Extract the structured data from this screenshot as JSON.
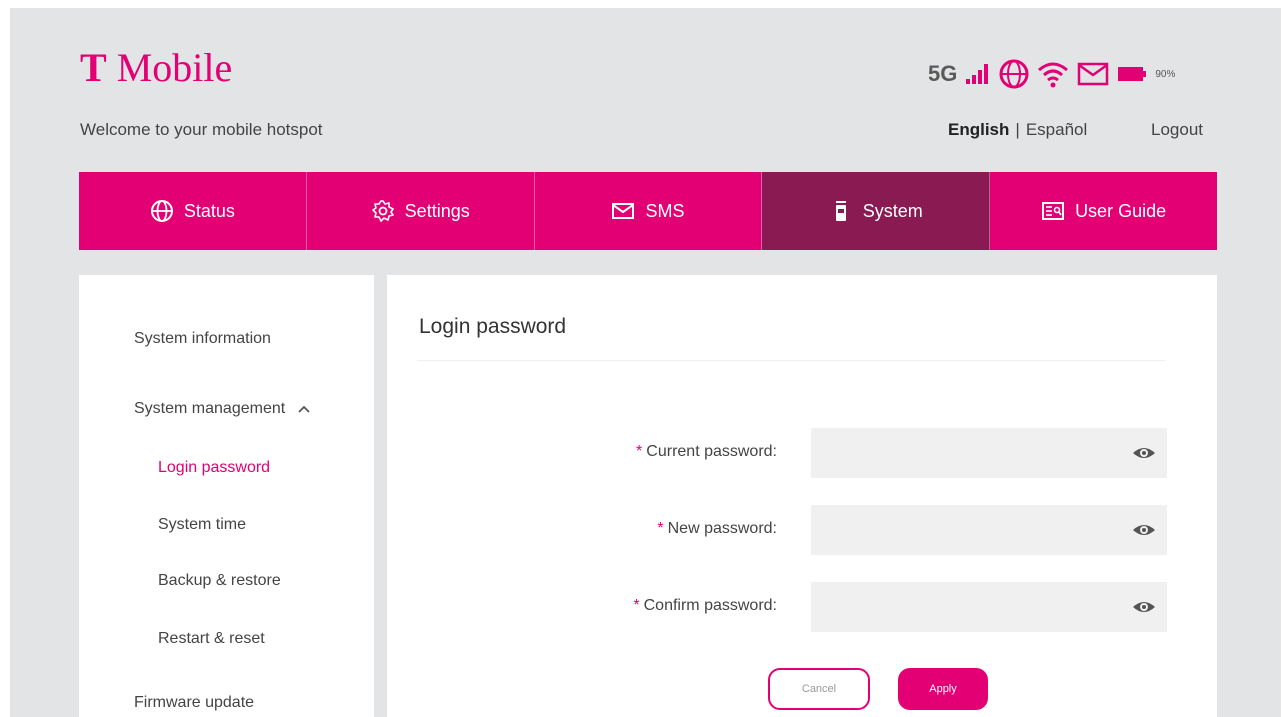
{
  "brand": {
    "logo_letter": "T",
    "name": "Mobile"
  },
  "status_bar": {
    "network": "5G",
    "battery_percent": "90%",
    "icons": [
      "signal-icon",
      "globe-icon",
      "wifi-icon",
      "mail-icon",
      "battery-icon"
    ]
  },
  "header": {
    "welcome": "Welcome to your mobile hotspot",
    "lang_english": "English",
    "lang_separator": "|",
    "lang_spanish": "Español",
    "logout": "Logout"
  },
  "nav": {
    "items": [
      {
        "label": "Status",
        "icon": "globe-icon"
      },
      {
        "label": "Settings",
        "icon": "gear-icon"
      },
      {
        "label": "SMS",
        "icon": "mail-icon"
      },
      {
        "label": "System",
        "icon": "device-icon"
      },
      {
        "label": "User Guide",
        "icon": "guide-icon"
      }
    ],
    "active": "System"
  },
  "sidebar": {
    "system_information": "System information",
    "system_management": "System management",
    "login_password": "Login password",
    "system_time": "System time",
    "backup_restore": "Backup & restore",
    "restart_reset": "Restart & reset",
    "firmware_update": "Firmware update"
  },
  "main": {
    "title": "Login password",
    "required_mark": "*",
    "current_password_label": "Current password:",
    "new_password_label": "New password:",
    "confirm_password_label": "Confirm password:",
    "cancel": "Cancel",
    "apply": "Apply"
  },
  "colors": {
    "accent": "#e20074",
    "accent_dark": "#8a1a52",
    "background": "#e3e4e6"
  }
}
